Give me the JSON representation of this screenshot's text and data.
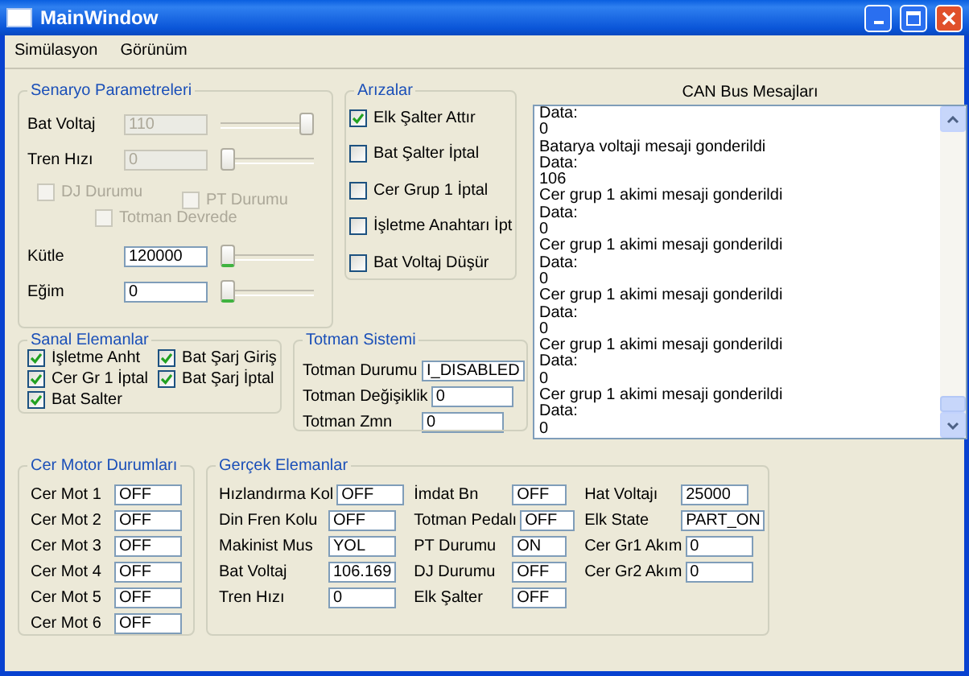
{
  "window": {
    "title": "MainWindow"
  },
  "menu": [
    "Simülasyon",
    "Görünüm"
  ],
  "scenario": {
    "title": "Senaryo Parametreleri",
    "sliders_top": [
      {
        "label": "Bat Voltaj",
        "value": "110",
        "disabled": true,
        "level": 1
      },
      {
        "label": "Tren Hızı",
        "value": "0",
        "disabled": true,
        "level": 0
      }
    ],
    "checks": [
      {
        "label": "DJ Durumu",
        "checked": false,
        "disabled": true
      },
      {
        "label": "PT Durumu",
        "checked": false,
        "disabled": true
      },
      {
        "label": "Totman Devrede",
        "checked": false,
        "disabled": true
      }
    ],
    "sliders_bottom": [
      {
        "label": "Kütle",
        "value": "120000",
        "disabled": false,
        "level": 0
      },
      {
        "label": "Eğim",
        "value": "0",
        "disabled": false,
        "level": 0
      }
    ]
  },
  "faults": {
    "title": "Arızalar",
    "items": [
      {
        "label": "Elk Şalter Attır",
        "checked": true
      },
      {
        "label": "Bat Şalter İptal",
        "checked": false
      },
      {
        "label": "Cer Grup 1 İptal",
        "checked": false
      },
      {
        "label": "İşletme Anahtarı İpt",
        "checked": false
      },
      {
        "label": "Bat Voltaj Düşür",
        "checked": false
      }
    ]
  },
  "can_bus": {
    "title": "CAN Bus Mesajları",
    "lines": [
      "Data:",
      "0",
      "Batarya voltaji mesaji gonderildi",
      "Data:",
      "106",
      "Cer grup 1 akimi mesaji gonderildi",
      "Data:",
      "0",
      "Cer grup 1 akimi mesaji gonderildi",
      "Data:",
      "0",
      "Cer grup 1 akimi mesaji gonderildi",
      "Data:",
      "0",
      "Cer grup 1 akimi mesaji gonderildi",
      "Data:",
      "0",
      "Cer grup 1 akimi mesaji gonderildi",
      "Data:",
      "0"
    ]
  },
  "virtual": {
    "title": "Sanal Elemanlar",
    "items": [
      {
        "label": "İşletme Anht",
        "checked": true
      },
      {
        "label": "Bat Şarj Giriş",
        "checked": true
      },
      {
        "label": "Cer Gr 1 İptal",
        "checked": true
      },
      {
        "label": "Bat Şarj İptal",
        "checked": true
      },
      {
        "label": "Bat Salter",
        "checked": true
      }
    ]
  },
  "totman": {
    "title": "Totman Sistemi",
    "fields": [
      {
        "label": "Totman Durumu",
        "value": "I_DISABLED"
      },
      {
        "label": "Totman Değişiklik",
        "value": "0"
      },
      {
        "label": "Totman Zmn",
        "value": "0"
      }
    ]
  },
  "motors": {
    "title": "Cer Motor Durumları",
    "fields": [
      {
        "label": "Cer Mot 1",
        "value": "OFF"
      },
      {
        "label": "Cer Mot 2",
        "value": "OFF"
      },
      {
        "label": "Cer Mot 3",
        "value": "OFF"
      },
      {
        "label": "Cer Mot 4",
        "value": "OFF"
      },
      {
        "label": "Cer Mot 5",
        "value": "OFF"
      },
      {
        "label": "Cer Mot 6",
        "value": "OFF"
      }
    ]
  },
  "real": {
    "title": "Gerçek Elemanlar",
    "columns": [
      [
        {
          "label": "Hızlandırma Kol",
          "value": "OFF"
        },
        {
          "label": "Din Fren Kolu",
          "value": "OFF"
        },
        {
          "label": "Makinist Mus",
          "value": "YOL"
        },
        {
          "label": "Bat Voltaj",
          "value": "106.169"
        },
        {
          "label": "Tren Hızı",
          "value": "0"
        }
      ],
      [
        {
          "label": "İmdat Bn",
          "value": "OFF"
        },
        {
          "label": "Totman Pedalı",
          "value": "OFF"
        },
        {
          "label": "PT Durumu",
          "value": "ON"
        },
        {
          "label": "DJ Durumu",
          "value": "OFF"
        },
        {
          "label": "Elk Şalter",
          "value": "OFF"
        }
      ],
      [
        {
          "label": "Hat Voltajı",
          "value": "25000"
        },
        {
          "label": "Elk State",
          "value": "PART_ON"
        },
        {
          "label": "Cer Gr1 Akım",
          "value": "0"
        },
        {
          "label": "Cer Gr2 Akım",
          "value": "0"
        }
      ]
    ]
  }
}
